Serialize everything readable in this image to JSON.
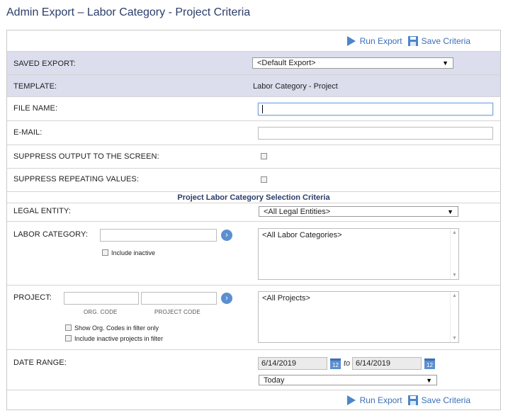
{
  "page": {
    "title": "Admin Export – Labor Category - Project Criteria"
  },
  "toolbar": {
    "run_export": "Run Export",
    "save_criteria": "Save Criteria"
  },
  "saved_export": {
    "label": "SAVED EXPORT:",
    "value": "<Default Export>"
  },
  "template": {
    "label": "TEMPLATE:",
    "value": "Labor Category - Project"
  },
  "file_name": {
    "label": "FILE NAME:",
    "value": ""
  },
  "email": {
    "label": "E-MAIL:",
    "value": ""
  },
  "suppress_output": {
    "label": "SUPPRESS OUTPUT TO THE SCREEN:"
  },
  "suppress_repeating": {
    "label": "SUPPRESS REPEATING VALUES:"
  },
  "section": {
    "title": "Project Labor Category Selection Criteria"
  },
  "legal_entity": {
    "label": "LEGAL ENTITY:",
    "value": "<All Legal Entities>"
  },
  "labor_category": {
    "label": "LABOR CATEGORY:",
    "include_inactive": "Include inactive",
    "list_item": "<All Labor Categories>"
  },
  "project": {
    "label": "PROJECT:",
    "org_code_caption": "ORG. CODE",
    "project_code_caption": "PROJECT CODE",
    "show_org_codes": "Show Org. Codes in filter only",
    "include_inactive_projects": "Include inactive projects in filter",
    "list_item": "<All Projects>"
  },
  "date_range": {
    "label": "DATE RANGE:",
    "from": "6/14/2019",
    "to_label": "to",
    "to": "6/14/2019",
    "calendar_day": "12",
    "preset": "Today"
  },
  "colors": {
    "accent": "#3b6fb6",
    "shaded_row": "#dcdeee",
    "title": "#2b3d6b"
  },
  "icons": [
    "play-icon",
    "save-disk-icon",
    "chevron-right-icon",
    "calendar-icon",
    "dropdown-arrow-icon"
  ]
}
